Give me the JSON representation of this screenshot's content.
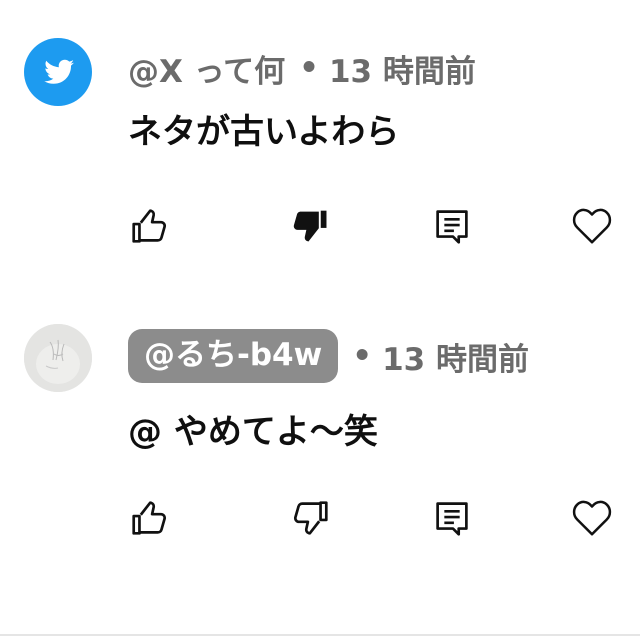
{
  "comments": [
    {
      "avatar_icon": "twitter-bird-icon",
      "handle": "@X って何",
      "separator": "•",
      "time": "13 時間前",
      "text": "ネタが古いよわら",
      "actions": {
        "like_icon": "thumbs-up-outline-icon",
        "dislike_icon": "thumbs-down-filled-icon",
        "disliked": true,
        "reply_icon": "reply-comment-icon",
        "heart_icon": "heart-outline-icon"
      }
    },
    {
      "avatar_icon": "user-photo-avatar",
      "handle": "@るち-b4w",
      "handle_highlighted": true,
      "separator": "•",
      "time": "13 時間前",
      "text": "@ やめてよ〜笑",
      "actions": {
        "like_icon": "thumbs-up-outline-icon",
        "dislike_icon": "thumbs-down-outline-icon",
        "disliked": false,
        "reply_icon": "reply-comment-icon",
        "heart_icon": "heart-outline-icon"
      }
    }
  ],
  "colors": {
    "twitter_blue": "#1d9bf0",
    "meta_gray": "#6b6b6b",
    "pill_gray": "#8c8c8c",
    "text": "#0f0f0f"
  }
}
